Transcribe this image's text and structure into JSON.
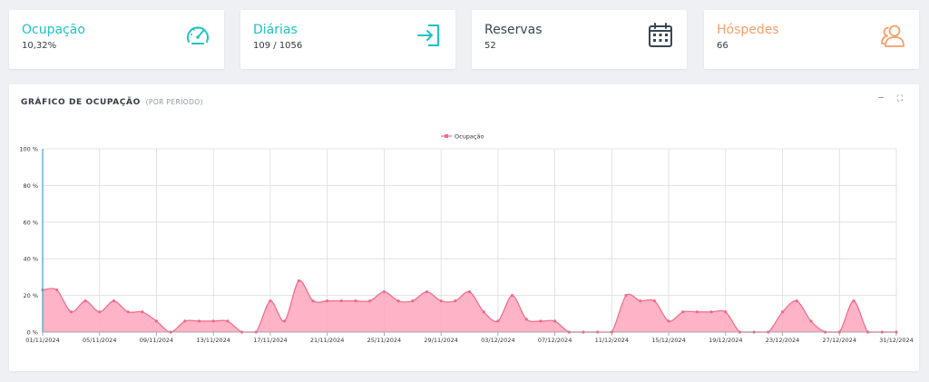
{
  "cards": [
    {
      "title": "Ocupação",
      "value": "10,32%",
      "color": "#1ec3c3",
      "icon": "speedometer-icon"
    },
    {
      "title": "Diárias",
      "value": "109 / 1056",
      "color": "#1ec3c3",
      "icon": "sign-in-icon"
    },
    {
      "title": "Reservas",
      "value": "52",
      "color": "#3b4553",
      "icon": "calendar-icon"
    },
    {
      "title": "Hóspedes",
      "value": "66",
      "color": "#f5a06a",
      "icon": "users-icon"
    }
  ],
  "panel": {
    "title": "GRÁFICO DE OCUPAÇÃO",
    "subtitle": "(POR PERÍODO)",
    "minimize_label": "–",
    "expand_label": "⛶"
  },
  "chart_data": {
    "type": "area",
    "series": [
      {
        "name": "Ocupação",
        "color": "#f06a8a",
        "fill": "#ffa6bc",
        "values": [
          23,
          23,
          11,
          17,
          11,
          17,
          11,
          11,
          6,
          0,
          6,
          6,
          6,
          6,
          0,
          0,
          17,
          6,
          28,
          17,
          17,
          17,
          17,
          17,
          22,
          17,
          17,
          22,
          17,
          17,
          22,
          11,
          6,
          20,
          7,
          6,
          6,
          0,
          0,
          0,
          0,
          20,
          17,
          17,
          6,
          11,
          11,
          11,
          11,
          0,
          0,
          0,
          11,
          17,
          6,
          0,
          0,
          17,
          0,
          0,
          0
        ]
      }
    ],
    "x_tick_labels": [
      "01/11/2024",
      "05/11/2024",
      "09/11/2024",
      "13/11/2024",
      "17/11/2024",
      "21/11/2024",
      "25/11/2024",
      "29/11/2024",
      "03/12/2024",
      "07/12/2024",
      "11/12/2024",
      "15/12/2024",
      "19/12/2024",
      "23/12/2024",
      "27/12/2024",
      "31/12/2024"
    ],
    "y_tick_labels": [
      "0 %",
      "20 %",
      "40 %",
      "60 %",
      "80 %",
      "100 %"
    ],
    "ylim": [
      0,
      100
    ],
    "grid": true,
    "legend_position": "top-center"
  }
}
